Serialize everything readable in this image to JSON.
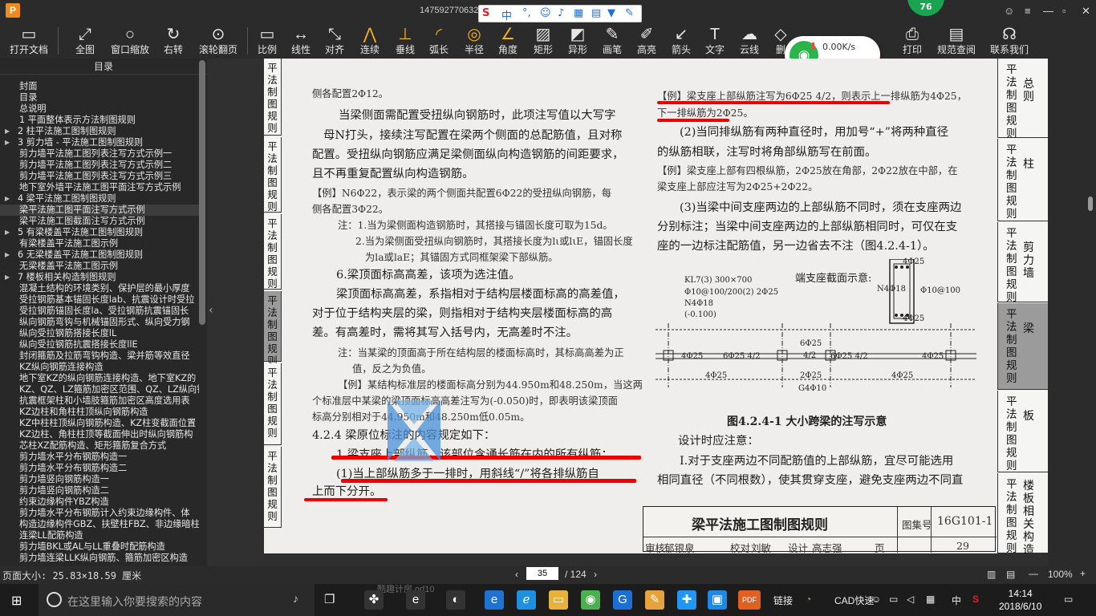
{
  "window": {
    "title": "147592770632",
    "badge": "76",
    "ime_mode": "中"
  },
  "toolbar": [
    "打开文档",
    "全图",
    "窗口缩放",
    "右转",
    "滚轮翻页",
    "比例",
    "线性",
    "对齐",
    "连续",
    "垂线",
    "弧长",
    "半径",
    "角度",
    "矩形",
    "异形",
    "画笔",
    "高亮",
    "箭头",
    "文字",
    "云线",
    "删",
    "打印",
    "规范查阅",
    "联系我们"
  ],
  "network": {
    "speed": "0.00K/s",
    "count": "0"
  },
  "sidebar": {
    "title": "目录",
    "items": [
      {
        "label": "封面",
        "level": 1,
        "arrow": ""
      },
      {
        "label": "目录",
        "level": 1,
        "arrow": ""
      },
      {
        "label": "总说明",
        "level": 1,
        "arrow": ""
      },
      {
        "label": "1 平面整体表示方法制图规则",
        "level": 1,
        "arrow": ""
      },
      {
        "label": "2 柱平法施工图制图规则",
        "level": 1,
        "arrow": "▶"
      },
      {
        "label": "3 剪力墙 - 平法施工图制图规则",
        "level": 1,
        "arrow": "▶"
      },
      {
        "label": "剪力墙平法施工图列表注写方式示例一",
        "level": 2,
        "arrow": ""
      },
      {
        "label": "剪力墙平法施工图列表注写方式示例二",
        "level": 2,
        "arrow": ""
      },
      {
        "label": "剪力墙平法施工图列表注写方式示例三",
        "level": 2,
        "arrow": ""
      },
      {
        "label": "地下室外墙平法施工图平面注写方式示例",
        "level": 2,
        "arrow": ""
      },
      {
        "label": "4 梁平法施工图制图规则",
        "level": 1,
        "arrow": "▶"
      },
      {
        "label": "梁平法施工图平面注写方式示例",
        "level": 2,
        "arrow": "",
        "sel": true
      },
      {
        "label": "梁平法施工图截面注写方式示例",
        "level": 2,
        "arrow": ""
      },
      {
        "label": "5 有梁楼盖平法施工图制图规则",
        "level": 1,
        "arrow": "▶"
      },
      {
        "label": "有梁楼盖平法施工图示例",
        "level": 2,
        "arrow": ""
      },
      {
        "label": "6 无梁楼盖平法施工图制图规则",
        "level": 1,
        "arrow": "▶"
      },
      {
        "label": "无梁楼盖平法施工图示例",
        "level": 2,
        "arrow": ""
      },
      {
        "label": "7 楼板相关构造制图规则",
        "level": 1,
        "arrow": "▶"
      },
      {
        "label": "混凝土结构的环境类别、保护层的最小厚度",
        "level": 2,
        "arrow": ""
      },
      {
        "label": "受拉钢筋基本锚固长度lab、抗震设计时受拉",
        "level": 2,
        "arrow": ""
      },
      {
        "label": "受拉钢筋锚固长度la、受拉钢筋抗震锚固长",
        "level": 2,
        "arrow": ""
      },
      {
        "label": "纵向钢筋弯钩与机械锚固形式、纵向受力钢",
        "level": 2,
        "arrow": ""
      },
      {
        "label": "纵向受拉钢筋搭接长度lL",
        "level": 2,
        "arrow": ""
      },
      {
        "label": "纵向受拉钢筋抗震搭接长度llE",
        "level": 2,
        "arrow": ""
      },
      {
        "label": "封闭箍筋及拉筋弯钩构造、梁并筋等效直径",
        "level": 2,
        "arrow": ""
      },
      {
        "label": "KZ纵向钢筋连接构造",
        "level": 2,
        "arrow": ""
      },
      {
        "label": "地下室KZ的纵向钢筋连接构造、地下室KZ的",
        "level": 2,
        "arrow": ""
      },
      {
        "label": "KZ、QZ、LZ箍筋加密区范围、QZ、LZ纵向钢",
        "level": 2,
        "arrow": ""
      },
      {
        "label": "抗震框架柱和小墙肢箍筋加密区高度选用表",
        "level": 2,
        "arrow": ""
      },
      {
        "label": "KZ边柱和角柱柱顶纵向钢筋构造",
        "level": 2,
        "arrow": ""
      },
      {
        "label": "KZ中柱柱顶纵向钢筋构造、KZ柱变截面位置",
        "level": 2,
        "arrow": ""
      },
      {
        "label": "KZ边柱、角柱柱顶等截面伸出时纵向钢筋构",
        "level": 2,
        "arrow": ""
      },
      {
        "label": "芯柱XZ配筋构造、矩形箍筋复合方式",
        "level": 2,
        "arrow": ""
      },
      {
        "label": "剪力墙水平分布钢筋构造一",
        "level": 2,
        "arrow": ""
      },
      {
        "label": "剪力墙水平分布钢筋构造二",
        "level": 2,
        "arrow": ""
      },
      {
        "label": "剪力墙竖向钢筋构造一",
        "level": 2,
        "arrow": ""
      },
      {
        "label": "剪力墙竖向钢筋构造二",
        "level": 2,
        "arrow": ""
      },
      {
        "label": "约束边缘构件YBZ构造",
        "level": 2,
        "arrow": ""
      },
      {
        "label": "剪力墙水平分布钢筋计入约束边缘构件、体",
        "level": 2,
        "arrow": ""
      },
      {
        "label": "构造边缘构件GBZ、扶壁柱FBZ、非边缘暗柱",
        "level": 2,
        "arrow": ""
      },
      {
        "label": "连梁LL配筋构造",
        "level": 2,
        "arrow": ""
      },
      {
        "label": "剪力墙BKL或AL与LL重叠时配筋构造",
        "level": 2,
        "arrow": ""
      },
      {
        "label": "剪力墙连梁LLK纵向钢筋、箍筋加密区构造",
        "level": 2,
        "arrow": ""
      }
    ]
  },
  "page": {
    "left_tabs": [
      "平法制图规则",
      "平法制图规则",
      "平法制图规则",
      "平法制图规则",
      "平法制图规则",
      "平法制图规则"
    ],
    "right_tabs": [
      {
        "a": "平法制图规则",
        "b": "总则"
      },
      {
        "a": "平法制图规则",
        "b": "柱"
      },
      {
        "a": "平法制图规则",
        "b": "剪力墙"
      },
      {
        "a": "平法制图规则",
        "b": "梁"
      },
      {
        "a": "平法制图规则",
        "b": "板"
      },
      {
        "a": "平法制图规则",
        "b": "楼板相关构造"
      }
    ],
    "left_text": [
      "侧各配置2Φ12。",
      "当梁侧面需配置受扭纵向钢筋时，此项注写值以大写字",
      "母N打头，接续注写配置在梁两个侧面的总配筋值，且对称",
      "配置。受扭纵向钢筋应满足梁侧面纵向构造钢筋的间距要求，",
      "且不再重复配置纵向构造钢筋。",
      "【例】N6Φ22，表示梁的两个侧面共配置6Φ22的受扭纵向钢筋，每",
      "侧各配置3Φ22。",
      "注：1.当为梁侧面构造钢筋时，其搭接与锚固长度可取为15d。",
      "2.当为梁侧面受扭纵向钢筋时，其搭接长度为lι或lιE，锚固长度",
      "为la或laE；其锚固方式同框架梁下部纵筋。",
      "6.梁顶面标高高差，该项为选注值。",
      "梁顶面标高高差，系指相对于结构层楼面标高的高差值，",
      "对于位于结构夹层的梁，则指相对于结构夹层楼面标高的高",
      "差。有高差时，需将其写入括号内，无高差时不注。",
      "注：当某梁的顶面高于所在结构层的楼面标高时，其标高高差为正",
      "值，反之为负值。",
      "【例】某结构标准层的楼面标高分别为44.950m和48.250m，当这两",
      "个标准层中某梁的梁顶面标高高差注写为(-0.050)时，即表明该梁顶面",
      "标高分别相对于44.950m和48.250m低0.05m。",
      "4.2.4 梁原位标注的内容规定如下：",
      "1.梁支座上部纵筋，该部位含通长筋在内的所有纵筋：",
      "(1)当上部纵筋多于一排时，用斜线“/”将各排纵筋自",
      "上而下分开。"
    ],
    "right_text": [
      "【例】梁支座上部纵筋注写为6Φ25 4/2，则表示上一排纵筋为4Φ25，",
      "下一排纵筋为2Φ25。",
      "(2)当同排纵筋有两种直径时，用加号“+”将两种直径",
      "的纵筋相联，注写时将角部纵筋写在前面。",
      "【例】梁支座上部有四根纵筋，2Φ25放在角部，2Φ22放在中部，在",
      "梁支座上部应注写为2Φ25+2Φ22。",
      "(3)当梁中间支座两边的上部纵筋不同时，须在支座两边",
      "分别标注；当梁中间支座两边的上部纵筋相同时，可仅在支",
      "座的一边标注配筋值，另一边省去不注（图4.2.4-1）。",
      "设计时应注意：",
      "Ⅰ.对于支座两边不同配筋值的上部纵筋，宜尽可能选用",
      "相同直径（不同根数），使其贯穿支座，避免支座两边不同直"
    ],
    "figure": {
      "caption": "图4.2.4-1 大小跨梁的注写示意",
      "section_label": "端支座截面示意:",
      "annot": [
        "KL7(3) 300×700",
        "Φ10@100/200(2) 2Φ25",
        "N4Φ18",
        "(-0.100)"
      ],
      "sec": {
        "top": "4Φ25",
        "n": "N4Φ18",
        "s": "Φ10@100",
        "bot": "4Φ25"
      },
      "beam": {
        "tl1": "4Φ25",
        "tl2": "6Φ25 4/2",
        "tm1": "6Φ25",
        "tm2": "4/2",
        "tr1": "6Φ25 4/2",
        "tr2": "4Φ25",
        "b1": "4Φ25",
        "bm1": "2Φ25",
        "bm2": "G4Φ10",
        "b2": "4Φ25"
      }
    },
    "title_block": {
      "title": "梁平法施工图制图规则",
      "atlas_label": "图集号",
      "atlas": "16G101-1",
      "row": [
        "审核",
        "郁银泉",
        "校对",
        "刘敏",
        "设计",
        "高志强",
        "页"
      ],
      "page": "29"
    }
  },
  "status": {
    "page_size": "页面大小: 25.83×18.59 厘米",
    "current_page": "35",
    "total_pages": "/ 124",
    "zoom": "100%"
  },
  "taskbar": {
    "search_placeholder": "在这里输入你要搜索的内容",
    "tray_link": "链接",
    "tray_cad": "CAD快速",
    "lang": "中",
    "time": "14:14",
    "date": "2018/6/10",
    "behind": "酷趣计房.gd10",
    "behind2": "下载gd10"
  },
  "colors": {
    "accent_red": "#e01010",
    "toolbar_bg": "#2b2b2b",
    "icon_yellow": "#f2b21c"
  }
}
